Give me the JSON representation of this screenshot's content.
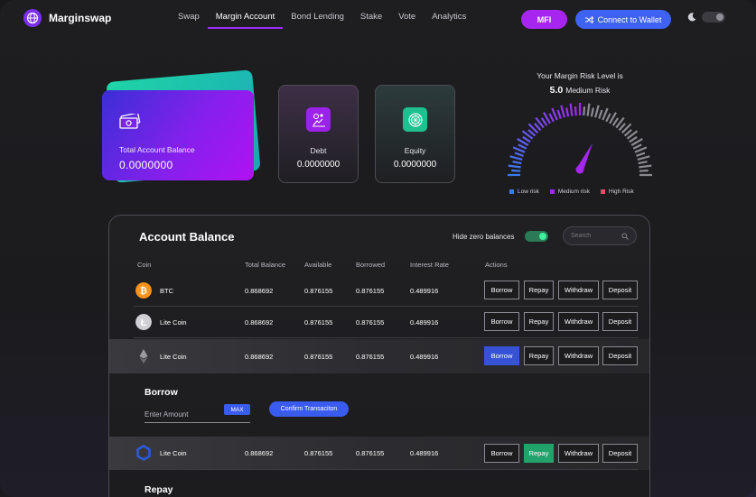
{
  "app": {
    "name": "Marginswap"
  },
  "nav": {
    "items": [
      {
        "label": "Swap"
      },
      {
        "label": "Margin Account",
        "active": true
      },
      {
        "label": "Bond Lending"
      },
      {
        "label": "Stake"
      },
      {
        "label": "Vote"
      },
      {
        "label": "Analytics"
      }
    ]
  },
  "header": {
    "mfi_label": "MFI",
    "wallet_label": "Connect to Wallet",
    "theme_icon": "moon-icon"
  },
  "balance_card": {
    "label": "Total Account Balance",
    "value": "0.0000000"
  },
  "debt_card": {
    "label": "Debt",
    "value": "0.0000000"
  },
  "equity_card": {
    "label": "Equity",
    "value": "0.0000000"
  },
  "risk": {
    "title": "Your Margin Risk Level is",
    "value": "5.0",
    "level": "Medium Risk",
    "gauge_fraction": 0.5,
    "legend": [
      {
        "label": "Low risk",
        "color": "#3a7bf0"
      },
      {
        "label": "Medium risk",
        "color": "#a626f0"
      },
      {
        "label": "High Risk",
        "color": "#f04a6a"
      }
    ]
  },
  "account": {
    "title": "Account Balance",
    "hide_zero_label": "Hide zero balances",
    "search_placeholder": "Search",
    "columns": [
      "Coin",
      "Total Balance",
      "Available",
      "Borrowed",
      "Interest Rate",
      "Actions"
    ],
    "actions": [
      "Borrow",
      "Repay",
      "Withdraw",
      "Deposit"
    ],
    "rows": [
      {
        "coin": "BTC",
        "total": "0.868692",
        "available": "0.876155",
        "borrowed": "0.876155",
        "rate": "0.489916",
        "icon": "bitcoin-icon"
      },
      {
        "coin": "Lite Coin",
        "total": "0.868692",
        "available": "0.876155",
        "borrowed": "0.876155",
        "rate": "0.489916",
        "icon": "litecoin-icon"
      },
      {
        "coin": "Lite Coin",
        "total": "0.868692",
        "available": "0.876155",
        "borrowed": "0.876155",
        "rate": "0.489916",
        "icon": "ethereum-icon"
      },
      {
        "coin": "Lite Coin",
        "total": "0.868692",
        "available": "0.876155",
        "borrowed": "0.876155",
        "rate": "0.489916",
        "icon": "chainlink-icon"
      }
    ],
    "borrow": {
      "title": "Borrow",
      "amount_placeholder": "Enter Amount",
      "max_label": "MAX",
      "confirm_label": "Confirm Transaciton"
    },
    "repay": {
      "title": "Repay"
    }
  }
}
